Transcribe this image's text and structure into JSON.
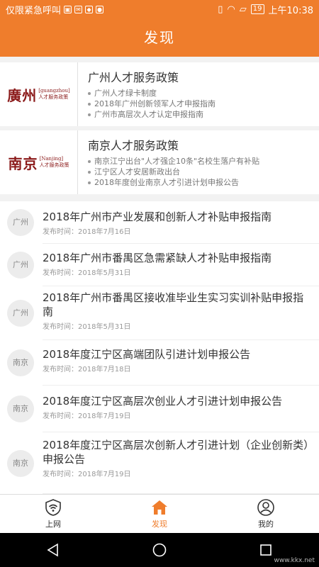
{
  "status_bar": {
    "left_text": "仅限紧急呼叫",
    "battery": "19",
    "time": "上午10:38"
  },
  "header": {
    "title": "发现"
  },
  "policies": [
    {
      "logo_main": "廣州",
      "logo_en": "[guangzhou]",
      "logo_sub": "人才服务政策",
      "title": "广州人才服务政策",
      "items": [
        "广州人才绿卡制度",
        "2018年广州创新领军人才申报指南",
        "广州市高层次人才认定申报指南"
      ]
    },
    {
      "logo_main": "南京",
      "logo_en": "[Nanjing]",
      "logo_sub": "人才服务政策",
      "title": "南京人才服务政策",
      "items": [
        "南京江宁出台\"人才强企10条\"名校生落户有补贴",
        "江宁区人才安居新政出台",
        "2018年度创业南京人才引进计划申报公告"
      ]
    }
  ],
  "news": [
    {
      "city": "广州",
      "title": "2018年广州市产业发展和创新人才补贴申报指南",
      "date_label": "发布时间：",
      "date": "2018年7月16日"
    },
    {
      "city": "广州",
      "title": "2018年广州市番禺区急需紧缺人才补贴申报指南",
      "date_label": "发布时间：",
      "date": "2018年5月31日"
    },
    {
      "city": "广州",
      "title": "2018年广州市番禺区接收准毕业生实习实训补贴申报指南",
      "date_label": "发布时间：",
      "date": "2018年5月31日"
    },
    {
      "city": "南京",
      "title": "2018年度江宁区高端团队引进计划申报公告",
      "date_label": "发布时间：",
      "date": "2018年7月18日"
    },
    {
      "city": "南京",
      "title": "2018年度江宁区高层次创业人才引进计划申报公告",
      "date_label": "发布时间：",
      "date": "2018年7月19日"
    },
    {
      "city": "南京",
      "title": "2018年度江宁区高层次创新人才引进计划（企业创新类）申报公告",
      "date_label": "发布时间：",
      "date": "2018年7月19日"
    }
  ],
  "bottom_nav": [
    {
      "label": "上网",
      "icon": "wifi-shield-icon"
    },
    {
      "label": "发现",
      "icon": "home-icon"
    },
    {
      "label": "我的",
      "icon": "user-icon"
    }
  ],
  "watermark": "www.kkx.net",
  "colors": {
    "accent": "#ef7d2c",
    "logo_red": "#8b1a1a"
  }
}
